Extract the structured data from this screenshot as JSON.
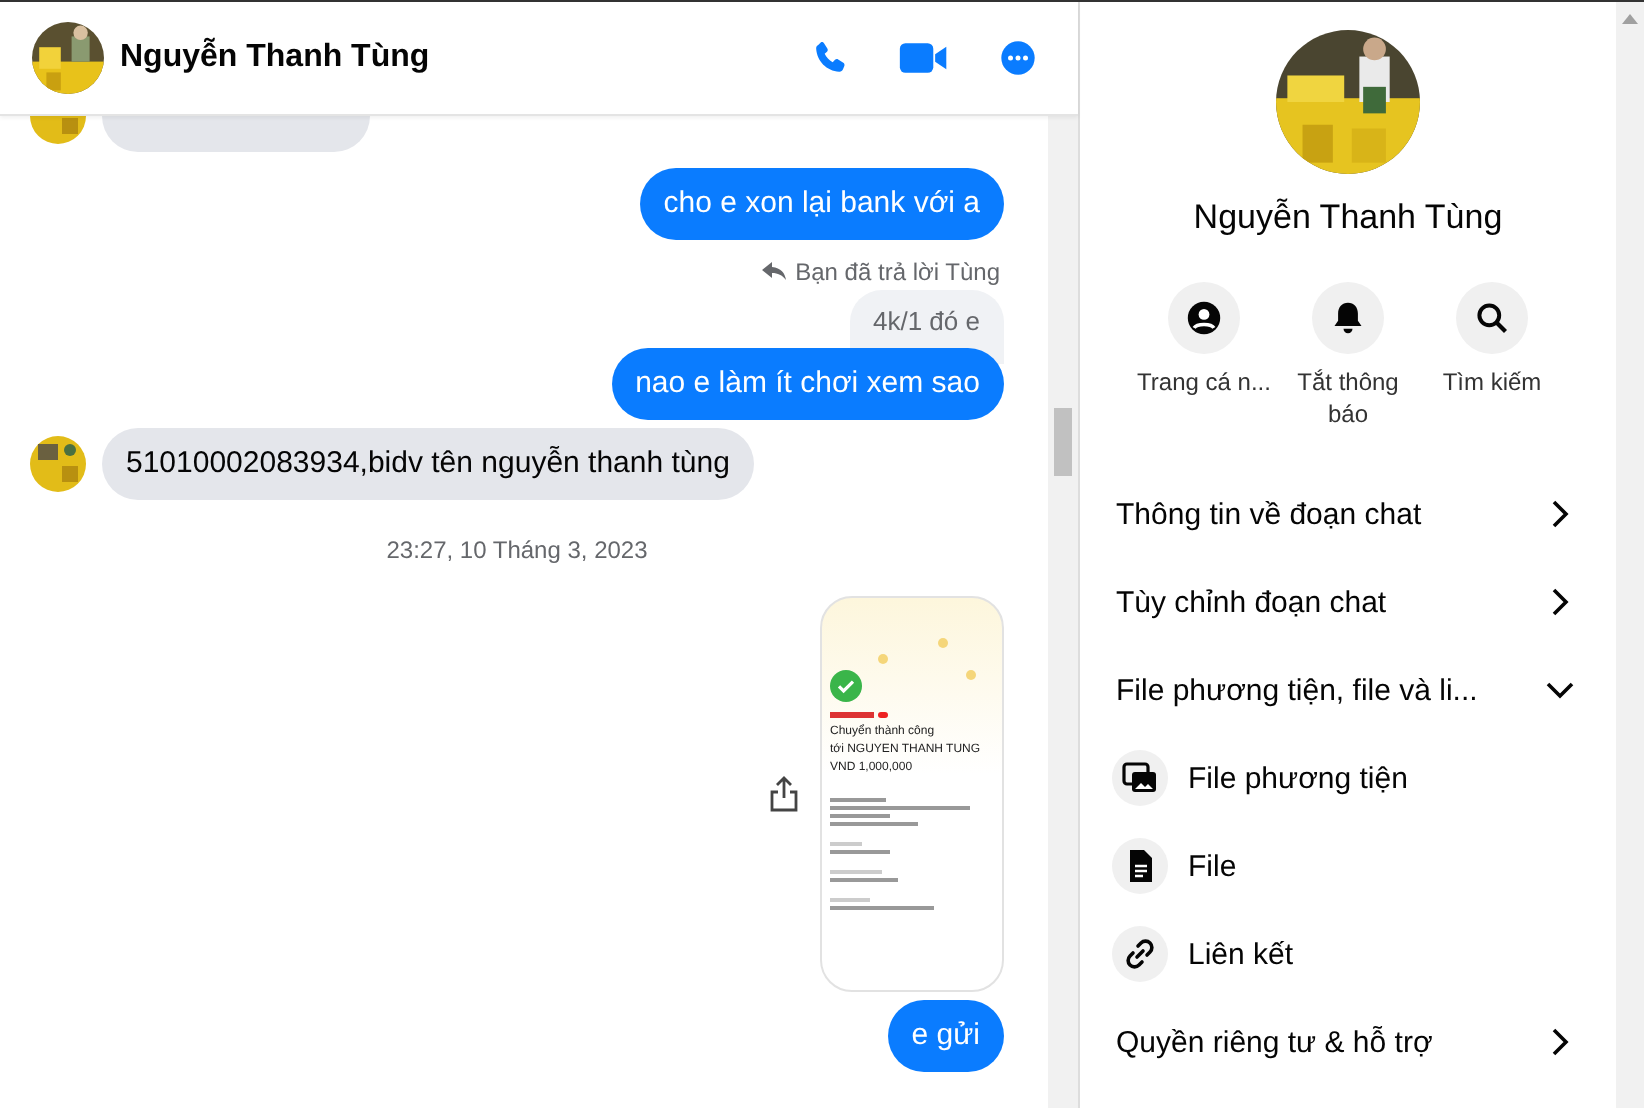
{
  "header": {
    "name": "Nguyễn Thanh Tùng"
  },
  "messages": [
    {
      "kind": "partial_incoming"
    },
    {
      "kind": "outgoing",
      "text": "cho e xon lại bank với a"
    },
    {
      "kind": "reply_label",
      "text": "Bạn đã trả lời Tùng"
    },
    {
      "kind": "quoted",
      "text": "4k/1 đó e"
    },
    {
      "kind": "outgoing",
      "text": "nao e làm ít chơi xem sao"
    },
    {
      "kind": "incoming",
      "text": "51010002083934,bidv tên nguyễn thanh tùng"
    },
    {
      "kind": "timestamp",
      "text": "23:27, 10 Tháng 3, 2023"
    },
    {
      "kind": "receipt",
      "lines": [
        "Chuyển thành công",
        "tới NGUYEN THANH TUNG",
        "VND 1,000,000"
      ]
    },
    {
      "kind": "outgoing",
      "text": "e gửi"
    }
  ],
  "profile": {
    "name": "Nguyễn Thanh Tùng"
  },
  "actions": [
    {
      "label": "Trang cá n..."
    },
    {
      "label": "Tắt thông báo"
    },
    {
      "label": "Tìm kiếm"
    }
  ],
  "menu": [
    {
      "kind": "section",
      "label": "Thông tin về đoạn chat",
      "expanded": false
    },
    {
      "kind": "section",
      "label": "Tùy chỉnh đoạn chat",
      "expanded": false
    },
    {
      "kind": "section",
      "label": "File phương tiện, file và li...",
      "expanded": true
    },
    {
      "kind": "media",
      "label": "File phương tiện"
    },
    {
      "kind": "file",
      "label": "File"
    },
    {
      "kind": "link",
      "label": "Liên kết"
    },
    {
      "kind": "section",
      "label": "Quyền riêng tư & hỗ trợ",
      "expanded": false
    }
  ]
}
